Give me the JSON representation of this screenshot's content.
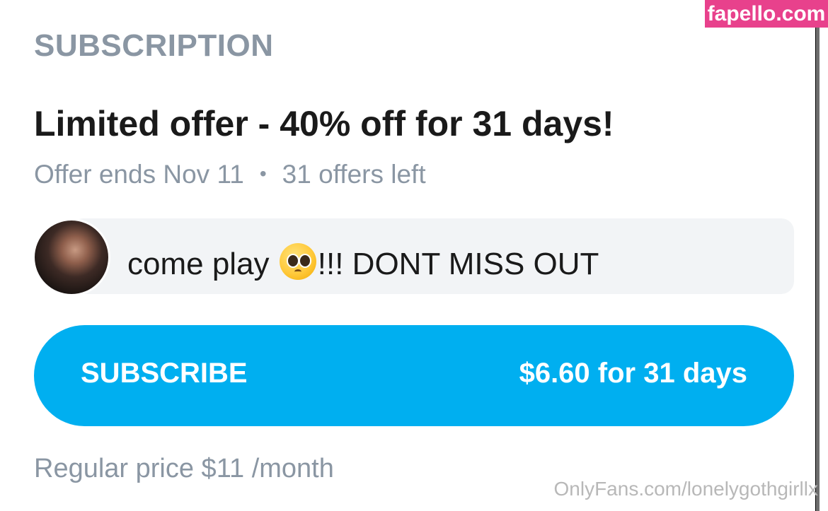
{
  "subscription": {
    "section_title": "SUBSCRIPTION",
    "offer_title": "Limited offer - 40% off for 31 days!",
    "offer_ends": "Offer ends Nov 11",
    "separator": "•",
    "offers_left": "31 offers left",
    "message": {
      "avatar_icon": "creator-avatar",
      "text_before_emoji": "come play ",
      "emoji": "pleading-face-emoji",
      "text_after_emoji": "!!! DONT MISS OUT"
    },
    "subscribe_button": {
      "label": "SUBSCRIBE",
      "price": "$6.60 for 31 days",
      "color": "#00aff0"
    },
    "regular_price": "Regular price $11 /month"
  },
  "watermarks": {
    "badge_text": "fapello.com",
    "badge_color": "#e8418c",
    "url_text": "OnlyFans.com/lonelygothgirllx"
  }
}
